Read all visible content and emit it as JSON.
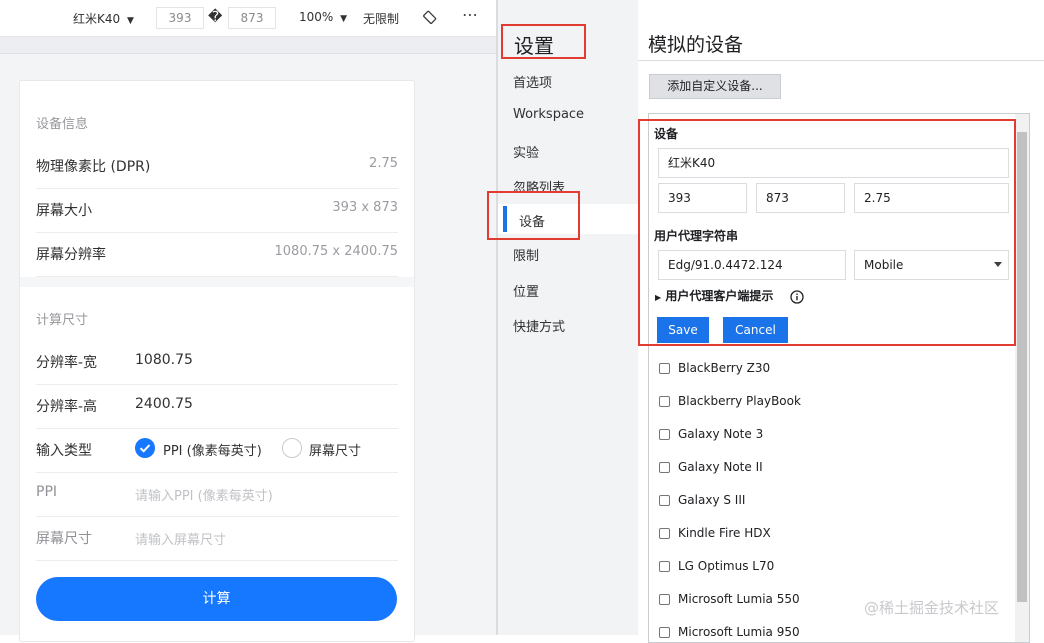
{
  "toolbar": {
    "device": "红米K40",
    "width": "393",
    "swap_glyph": "�",
    "height": "873",
    "zoom": "100%",
    "throttle": "无限制",
    "icons": [
      "chevron-down-icon",
      "rotate-icon",
      "more-icon"
    ]
  },
  "phone": {
    "device_info_title": "设备信息",
    "dpr": {
      "label": "物理像素比 (DPR)",
      "value": "2.75"
    },
    "screen_size": {
      "label": "屏幕大小",
      "value": "393 x 873"
    },
    "resolution": {
      "label": "屏幕分辨率",
      "value": "1080.75 x 2400.75"
    },
    "calc_title": "计算尺寸",
    "res_width": {
      "label": "分辨率-宽",
      "value": "1080.75"
    },
    "res_height": {
      "label": "分辨率-高",
      "value": "2400.75"
    },
    "input_type": {
      "label": "输入类型",
      "option_ppi": "PPI (像素每英寸)",
      "option_screen": "屏幕尺寸",
      "selected": "PPI (像素每英寸)"
    },
    "ppi": {
      "label": "PPI",
      "placeholder": "请输入PPI (像素每英寸)"
    },
    "screen_inch": {
      "label": "屏幕尺寸",
      "placeholder": "请输入屏幕尺寸"
    },
    "calc_button": "计算",
    "accent": "#1677ff"
  },
  "settings": {
    "title": "设置",
    "nav": [
      "首选项",
      "Workspace",
      "实验",
      "忽略列表",
      "设备",
      "限制",
      "位置",
      "快捷方式"
    ],
    "selected": "设备"
  },
  "content": {
    "title": "模拟的设备",
    "add_button": "添加自定义设备...",
    "device_label": "设备",
    "device_name": "红米K40",
    "width": "393",
    "height": "873",
    "dpr": "2.75",
    "ua_label": "用户代理字符串",
    "ua_value": "Edg/91.0.4472.124",
    "ua_type": "Mobile",
    "client_hints": "用户代理客户端提示",
    "save": "Save",
    "cancel": "Cancel",
    "devices": [
      "BlackBerry Z30",
      "Blackberry PlayBook",
      "Galaxy Note 3",
      "Galaxy Note II",
      "Galaxy S III",
      "Kindle Fire HDX",
      "LG Optimus L70",
      "Microsoft Lumia 550",
      "Microsoft Lumia 950"
    ],
    "accent": "#1a73e8",
    "highlight": "#e23b32"
  },
  "watermark": "@稀土掘金技术社区"
}
